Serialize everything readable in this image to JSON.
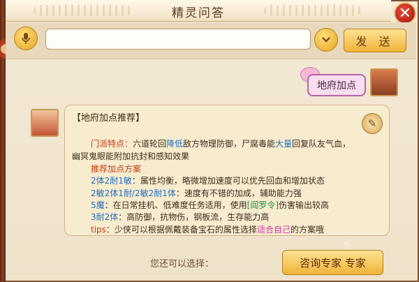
{
  "window": {
    "title": "精灵问答"
  },
  "input": {
    "value": "",
    "placeholder": "",
    "send_label": "发 送"
  },
  "user_message": "地府加点",
  "answer": {
    "title": "【地府加点推荐】",
    "sect_label": "门派特点：",
    "sect_text_a": "六道轮回",
    "sect_highlight_1": "降低",
    "sect_text_b": "敌方物理防御，尸腐毒能",
    "sect_highlight_2": "大量",
    "sect_text_c": "回复队友气血，",
    "sect_line2": "幽冥鬼眼能附加抗封和感知效果",
    "plan_header": "推荐加点方案",
    "plans": [
      {
        "name": "2体2耐1敏",
        "desc": "：属性均衡，略微增加速度可以优先回血和增加状态"
      },
      {
        "name": "2敏2体1耐/2敏2耐1体",
        "desc": "：速度有不错的加成，辅助能力强"
      },
      {
        "name": "5魔",
        "desc_a": "：在日常挂机、低难度任务适用，使用",
        "item": "[阎罗令]",
        "desc_b": "伤害输出较高"
      },
      {
        "name": "3耐2体",
        "desc": "：高防御，抗物伤，钢板流，生存能力高"
      }
    ],
    "tips_label": "tips",
    "tips_text_a": "：少侠可以根据佩戴装备宝石的属性选择",
    "tips_highlight": "适合自己",
    "tips_text_b": "的方案哦"
  },
  "footer": {
    "hint": "您还可以选择：",
    "button_label": "咨询专家 专家"
  },
  "colors": {
    "red": "#c43a12",
    "blue": "#1d6fc0",
    "green": "#1a8a3c",
    "pink": "#d231a8"
  }
}
